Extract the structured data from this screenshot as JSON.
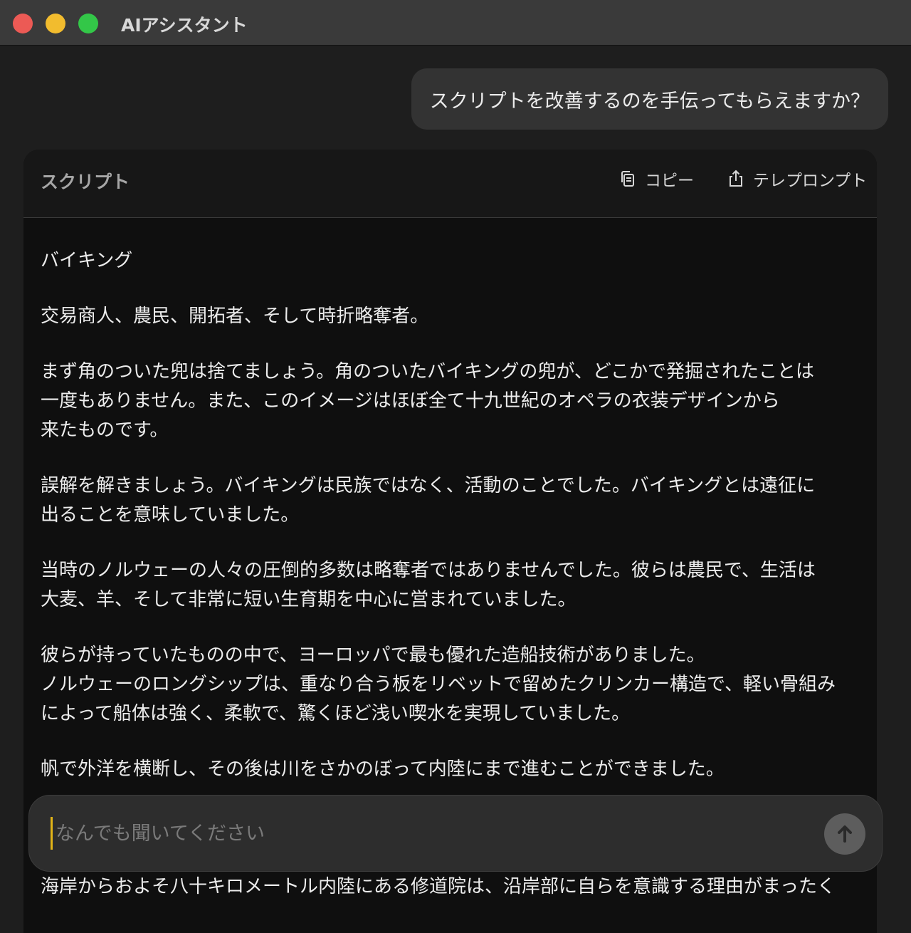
{
  "window": {
    "title": "AIアシスタント"
  },
  "chat": {
    "user_message": "スクリプトを改善するのを手伝ってもらえますか？"
  },
  "script_card": {
    "header_title": "スクリプト",
    "copy_label": "コピー",
    "teleprompt_label": "テレプロンプト",
    "paragraphs": [
      "バイキング",
      "交易商人、農民、開拓者、そして時折略奪者。",
      "まず角のついた兜は捨てましょう。角のついたバイキングの兜が、どこかで発掘されたことは\n一度もありません。また、このイメージはほぼ全て十九世紀のオペラの衣装デザインから\n来たものです。",
      "誤解を解きましょう。バイキングは民族ではなく、活動のことでした。バイキングとは遠征に\n出ることを意味していました。",
      "当時のノルウェーの人々の圧倒的多数は略奪者ではありませんでした。彼らは農民で、生活は\n大麦、羊、そして非常に短い生育期を中心に営まれていました。",
      "彼らが持っていたものの中で、ヨーロッパで最も優れた造船技術がありました。\nノルウェーのロングシップは、重なり合う板をリベットで留めたクリンカー構造で、軽い骨組み\nによって船体は強く、柔軟で、驚くほど浅い喫水を実現していました。",
      "帆で外洋を横断し、その後は川をさかのぼって内陸にまで進むことができました。"
    ],
    "overflow_line": "海岸からおよそ八十キロメートル内陸にある修道院は、沿岸部に自らを意識する理由がまったく"
  },
  "composer": {
    "placeholder": "なんでも聞いてください",
    "value": ""
  },
  "icons": {
    "copy": "copy-icon",
    "share": "share-icon",
    "send": "arrow-up-icon"
  }
}
